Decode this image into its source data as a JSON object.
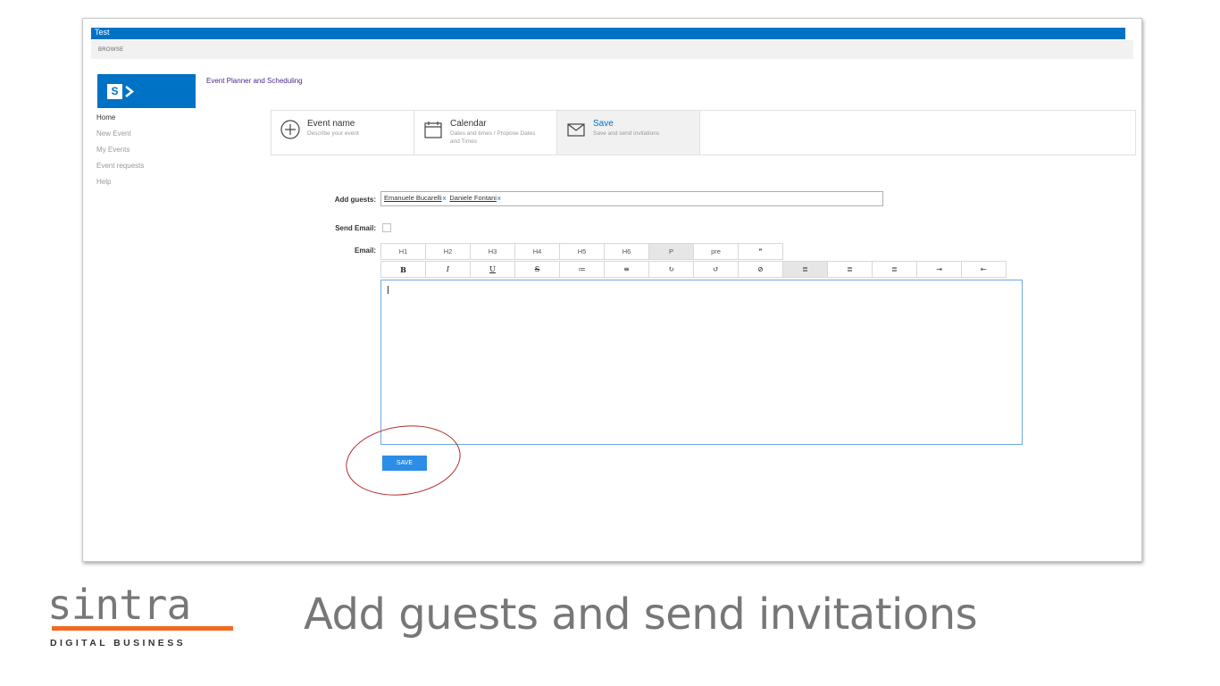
{
  "suite_bar": {
    "title": "Test"
  },
  "ribbon": {
    "tab": "BROWSE"
  },
  "site": {
    "title": "Event Planner and Scheduling"
  },
  "nav": [
    "Home",
    "New Event",
    "My Events",
    "Event requests",
    "Help"
  ],
  "wizard": [
    {
      "title": "Event name",
      "desc": "Describe your event",
      "icon": "plus-circle-icon"
    },
    {
      "title": "Calendar",
      "desc": "Dates and times / Propose Dates and Times",
      "icon": "calendar-icon"
    },
    {
      "title": "Save",
      "desc": "Save and send invitations",
      "icon": "envelope-icon"
    }
  ],
  "form": {
    "guests_label": "Add guests:",
    "guests": [
      "Emanuele Bucarelli",
      "Daniele Fontani"
    ],
    "remove_glyph": "x",
    "send_email_label": "Send Email:",
    "email_label": "Email:",
    "toolbar_row1": [
      "H1",
      "H2",
      "H3",
      "H4",
      "H5",
      "H6",
      "P",
      "pre",
      "❞"
    ],
    "toolbar_row2": [
      "B",
      "I",
      "U",
      "S",
      "≔",
      "≡",
      "↻",
      "↺",
      "⊘",
      "≣",
      "≣",
      "≣",
      "⇥",
      "⇤"
    ],
    "save_label": "SAVE"
  },
  "brand": {
    "name": "sintra",
    "tagline": "DIGITAL BUSINESS",
    "accent": "#f26a21"
  },
  "caption": "Add guests and send invitations",
  "colors": {
    "primary": "#0072c6",
    "button": "#2b8de8",
    "highlight": "#b22a2a"
  }
}
